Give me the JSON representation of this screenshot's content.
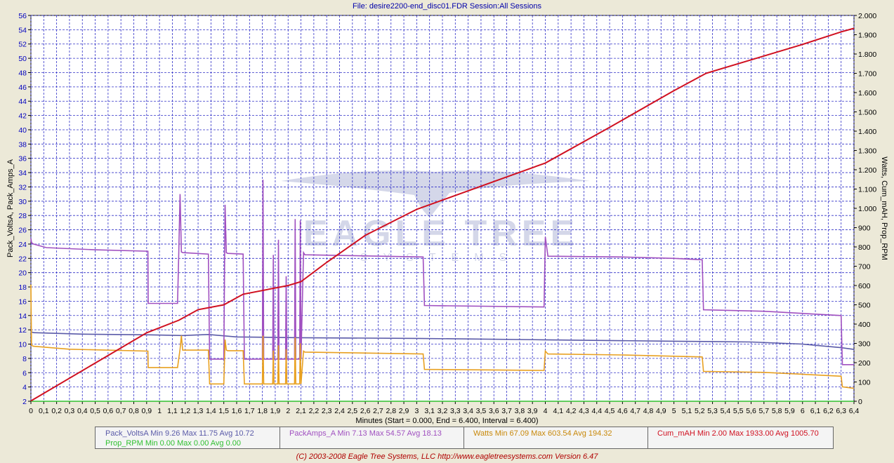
{
  "header": {
    "title": "File: desire2200-end_disc01.FDR   Session:All Sessions"
  },
  "footer": {
    "copyright": "(C) 2003-2008 Eagle Tree Systems, LLC      http://www.eagletreesystems.com      Version 6.47",
    "x_axis_title": "Minutes (Start = 0.000,  End = 6.400,  Interval =  6.400)"
  },
  "watermark": {
    "text": "EAGLE TREE",
    "subtext": "SYSTEMS"
  },
  "legend": {
    "volts": "Pack_VoltsA   Min 9.26   Max 11.75   Avg 10.72",
    "rpm": "Prop_RPM   Min 0.00   Max 0.00   Avg 0.00",
    "amps": "PackAmps_A   Min 7.13   Max 54.57   Avg 18.13",
    "watts": "Watts   Min 67.09   Max 603.54   Avg 194.32",
    "mah": "Cum_mAH   Min 2.00   Max 1933.00   Avg 1005.70"
  },
  "chart_data": {
    "type": "line",
    "title": "File: desire2200-end_disc01.FDR   Session:All Sessions",
    "xlabel": "Minutes (Start = 0.000,  End = 6.400,  Interval =  6.400)",
    "ylabel_left": "Pack_VoltsA, Pack_Amps_A",
    "ylabel_right": "Watts, Cum_mAH, Prop_RPM",
    "xlim": [
      0,
      6.4
    ],
    "ylim_left": [
      2,
      56
    ],
    "ylim_right": [
      0,
      2000
    ],
    "x_ticks": [
      "0",
      "0,1",
      "0,2",
      "0,3",
      "0,4",
      "0,5",
      "0,6",
      "0,7",
      "0,8",
      "0,9",
      "1",
      "1,1",
      "1,2",
      "1,3",
      "1,4",
      "1,5",
      "1,6",
      "1,7",
      "1,8",
      "1,9",
      "2",
      "2,1",
      "2,2",
      "2,3",
      "2,4",
      "2,5",
      "2,6",
      "2,7",
      "2,8",
      "2,9",
      "3",
      "3,1",
      "3,2",
      "3,3",
      "3,4",
      "3,5",
      "3,6",
      "3,7",
      "3,8",
      "3,9",
      "4",
      "4,1",
      "4,2",
      "4,3",
      "4,4",
      "4,5",
      "4,6",
      "4,7",
      "4,8",
      "4,9",
      "5",
      "5,1",
      "5,2",
      "5,3",
      "5,4",
      "5,5",
      "5,6",
      "5,7",
      "5,8",
      "5,9",
      "6",
      "6,1",
      "6,2",
      "6,3",
      "6,4"
    ],
    "y_ticks_left": [
      "2",
      "4",
      "6",
      "8",
      "10",
      "12",
      "14",
      "16",
      "18",
      "20",
      "22",
      "24",
      "26",
      "28",
      "30",
      "32",
      "34",
      "36",
      "38",
      "40",
      "42",
      "44",
      "46",
      "48",
      "50",
      "52",
      "54",
      "56"
    ],
    "y_ticks_right": [
      "0",
      "100",
      "200",
      "300",
      "400",
      "500",
      "600",
      "700",
      "800",
      "900",
      "1.000",
      "1.100",
      "1.200",
      "1.300",
      "1.400",
      "1.500",
      "1.600",
      "1.700",
      "1.800",
      "1.900",
      "2.000"
    ],
    "grid": true,
    "series": [
      {
        "name": "Pack_VoltsA",
        "axis": "left",
        "color": "#5a5aa8",
        "x": [
          0,
          0.02,
          0.4,
          0.92,
          1.18,
          1.38,
          1.6,
          2.1,
          3.0,
          4.0,
          5.0,
          5.6,
          6.0,
          6.3,
          6.4
        ],
        "y": [
          11.75,
          11.6,
          11.4,
          11.3,
          11.2,
          11.35,
          11.0,
          10.9,
          10.8,
          10.6,
          10.4,
          10.3,
          10.0,
          9.5,
          9.26
        ]
      },
      {
        "name": "PackAmps_A",
        "axis": "left",
        "color": "#a050c0",
        "x": [
          0,
          0.005,
          0.02,
          0.12,
          0.5,
          0.91,
          0.912,
          1.14,
          1.15,
          1.16,
          1.17,
          1.18,
          1.38,
          1.39,
          1.5,
          1.51,
          1.52,
          1.53,
          1.65,
          1.66,
          1.8,
          1.805,
          1.81,
          1.88,
          1.885,
          1.89,
          1.92,
          1.925,
          1.93,
          1.98,
          1.985,
          1.99,
          2.05,
          2.055,
          2.06,
          2.09,
          2.095,
          2.1,
          2.12,
          2.13,
          3.05,
          3.06,
          3.99,
          4.0,
          4.02,
          4.6,
          5.0,
          5.22,
          5.23,
          5.7,
          6.3,
          6.31,
          6.4
        ],
        "y": [
          24.8,
          24.2,
          24.0,
          23.5,
          23.2,
          23.0,
          15.7,
          15.7,
          22.9,
          31.0,
          22.9,
          22.8,
          22.6,
          7.9,
          7.9,
          29.5,
          22.8,
          22.7,
          22.6,
          7.9,
          7.9,
          33.0,
          7.9,
          7.9,
          22.5,
          7.9,
          7.9,
          24.6,
          7.9,
          7.9,
          19.5,
          7.9,
          7.9,
          27.5,
          7.9,
          7.9,
          27.3,
          7.9,
          22.8,
          22.5,
          22.2,
          15.4,
          15.2,
          25.0,
          22.3,
          22.2,
          22.0,
          21.8,
          14.8,
          14.6,
          14.0,
          7.13,
          7.13
        ]
      },
      {
        "name": "Watts",
        "axis": "right",
        "color": "#e8a020",
        "x": [
          0,
          0.005,
          0.02,
          0.3,
          0.91,
          0.912,
          1.14,
          1.16,
          1.17,
          1.18,
          1.38,
          1.39,
          1.5,
          1.51,
          1.52,
          1.53,
          1.65,
          1.66,
          1.8,
          1.805,
          1.81,
          1.88,
          1.885,
          1.89,
          1.92,
          1.925,
          1.93,
          1.98,
          1.985,
          1.99,
          2.05,
          2.055,
          2.06,
          2.09,
          2.095,
          2.1,
          2.12,
          2.13,
          3.05,
          3.06,
          3.99,
          4.0,
          4.02,
          4.6,
          5.22,
          5.23,
          5.7,
          6.3,
          6.31,
          6.4
        ],
        "y": [
          603.54,
          290,
          285,
          270,
          260,
          175,
          175,
          270,
          340,
          265,
          265,
          90,
          90,
          320,
          265,
          262,
          262,
          90,
          90,
          340,
          90,
          90,
          262,
          90,
          90,
          290,
          90,
          90,
          270,
          90,
          90,
          330,
          90,
          90,
          300,
          90,
          260,
          255,
          245,
          165,
          160,
          260,
          245,
          240,
          230,
          155,
          150,
          130,
          75,
          67.09
        ]
      },
      {
        "name": "Prop_RPM",
        "axis": "right",
        "color": "#30c030",
        "x": [
          0,
          6.4
        ],
        "y": [
          0,
          0
        ]
      },
      {
        "name": "Cum_mAH",
        "axis": "right",
        "color": "#d01020",
        "x": [
          0,
          0.9,
          1.15,
          1.3,
          1.5,
          1.65,
          2.0,
          2.1,
          2.3,
          2.6,
          3.0,
          3.5,
          4.0,
          4.5,
          5.0,
          5.25,
          5.6,
          6.0,
          6.3,
          6.4
        ],
        "y": [
          2,
          355,
          420,
          475,
          500,
          555,
          600,
          620,
          720,
          860,
          995,
          1115,
          1235,
          1420,
          1610,
          1700,
          1770,
          1850,
          1915,
          1933
        ]
      }
    ]
  }
}
